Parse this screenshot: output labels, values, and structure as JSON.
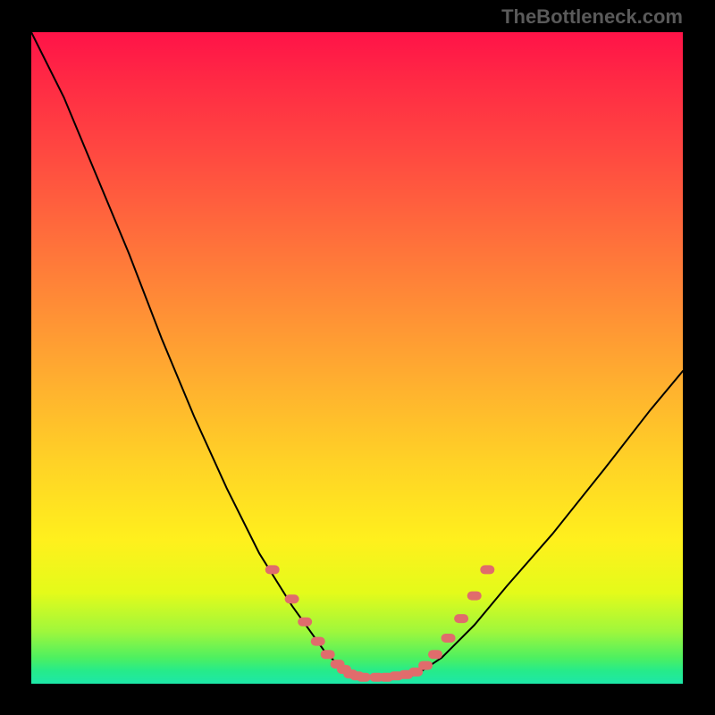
{
  "attribution": "TheBottleneck.com",
  "chart_data": {
    "type": "line",
    "title": "",
    "xlabel": "",
    "ylabel": "",
    "xlim": [
      0,
      1
    ],
    "ylim": [
      0,
      1
    ],
    "series": [
      {
        "name": "curve",
        "x": [
          0.0,
          0.05,
          0.1,
          0.15,
          0.2,
          0.25,
          0.3,
          0.35,
          0.4,
          0.45,
          0.48,
          0.5,
          0.52,
          0.55,
          0.58,
          0.6,
          0.63,
          0.68,
          0.73,
          0.8,
          0.88,
          0.95,
          1.0
        ],
        "y": [
          1.0,
          0.9,
          0.78,
          0.66,
          0.53,
          0.41,
          0.3,
          0.2,
          0.12,
          0.05,
          0.02,
          0.01,
          0.01,
          0.01,
          0.01,
          0.02,
          0.04,
          0.09,
          0.15,
          0.23,
          0.33,
          0.42,
          0.48
        ]
      },
      {
        "name": "dots-left",
        "x": [
          0.37,
          0.4,
          0.42,
          0.44,
          0.455,
          0.47,
          0.48,
          0.49,
          0.5
        ],
        "y": [
          0.175,
          0.13,
          0.095,
          0.065,
          0.045,
          0.03,
          0.022,
          0.015,
          0.012
        ]
      },
      {
        "name": "dots-bottom",
        "x": [
          0.51,
          0.53,
          0.545,
          0.56,
          0.575,
          0.59
        ],
        "y": [
          0.01,
          0.01,
          0.01,
          0.012,
          0.014,
          0.018
        ]
      },
      {
        "name": "dots-right",
        "x": [
          0.605,
          0.62,
          0.64,
          0.66,
          0.68,
          0.7
        ],
        "y": [
          0.028,
          0.045,
          0.07,
          0.1,
          0.135,
          0.175
        ]
      }
    ],
    "colors": {
      "curve": "#000000",
      "dots": "#e06c6c"
    }
  }
}
